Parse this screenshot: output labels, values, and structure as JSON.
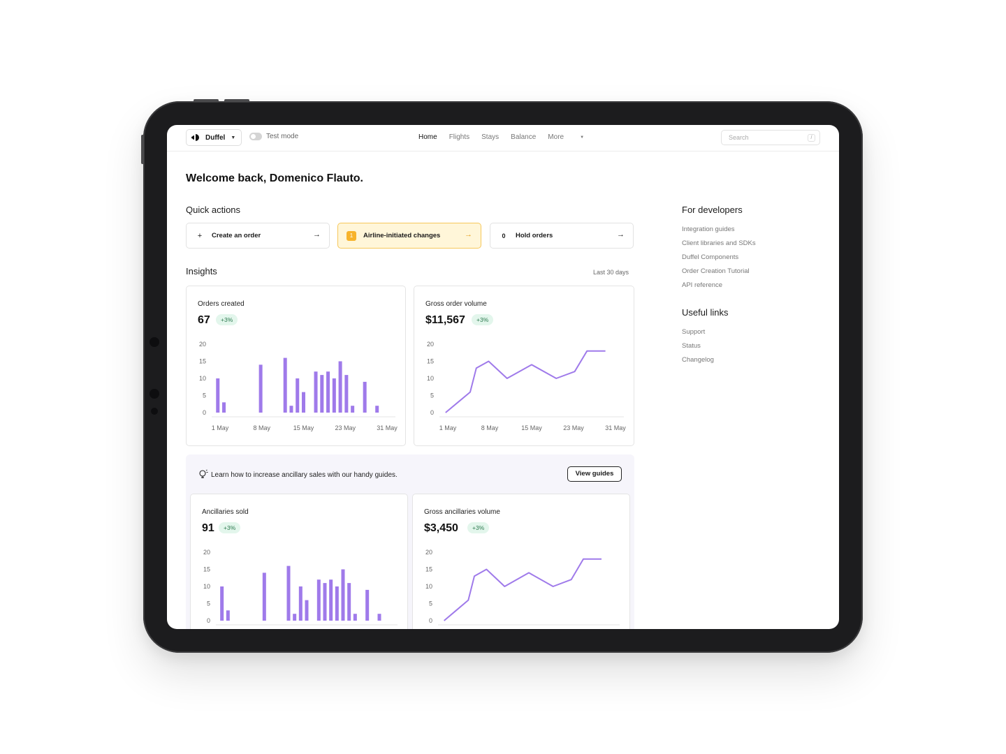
{
  "header": {
    "org_name": "Duffel",
    "test_mode_label": "Test mode",
    "nav": [
      "Home",
      "Flights",
      "Stays",
      "Balance",
      "More"
    ],
    "search_placeholder": "Search",
    "search_shortcut": "/"
  },
  "welcome": "Welcome back, Domenico Flauto.",
  "quick_actions": {
    "title": "Quick actions",
    "items": [
      {
        "label": "Create an order",
        "lead": "+"
      },
      {
        "label": "Airline-initiated changes",
        "lead": "1"
      },
      {
        "label": "Hold orders",
        "lead": "0"
      }
    ],
    "arrow": "→"
  },
  "insights": {
    "title": "Insights",
    "range": "Last 30 days"
  },
  "cards": [
    {
      "title": "Orders created",
      "value": "67",
      "change": "+3%"
    },
    {
      "title": "Gross order volume",
      "value": "$11,567",
      "change": "+3%"
    },
    {
      "title": "Ancillaries sold",
      "value": "91",
      "change": "+3%"
    },
    {
      "title": "Gross ancillaries volume",
      "value": "$3,450",
      "change": "+3%"
    }
  ],
  "promo": {
    "text": "Learn how to increase ancillary sales with our handy guides.",
    "button": "View guides"
  },
  "developers": {
    "title": "For developers",
    "links": [
      "Integration guides",
      "Client libraries and SDKs",
      "Duffel Components",
      "Order Creation Tutorial",
      "API reference"
    ]
  },
  "useful_links": {
    "title": "Useful links",
    "links": [
      "Support",
      "Status",
      "Changelog"
    ]
  },
  "colors": {
    "accent": "#9f7aea",
    "warning_bg": "#fff6d9",
    "warning_border": "#f6c75a",
    "badge_bg": "#e3f6ec"
  },
  "chart_data": [
    {
      "type": "bar",
      "x": [
        1,
        2,
        8,
        12,
        13,
        14,
        15,
        17,
        18,
        19,
        20,
        21,
        22,
        23,
        25,
        27
      ],
      "values": [
        10,
        3,
        14,
        16,
        2,
        10,
        6,
        12,
        11,
        12,
        10,
        15,
        11,
        2,
        9,
        2
      ],
      "xticks": [
        "1 May",
        "8 May",
        "15 May",
        "23 May",
        "31 May"
      ],
      "yticks": [
        "20",
        "15",
        "10",
        "5",
        "0"
      ],
      "ylim": [
        0,
        20
      ]
    },
    {
      "type": "line",
      "x": [
        1,
        3,
        5,
        6,
        8,
        11,
        15,
        19,
        22,
        24,
        25,
        27
      ],
      "values": [
        0,
        3,
        6,
        13,
        15,
        10,
        14,
        10,
        12,
        18,
        18,
        18
      ],
      "xticks": [
        "1 May",
        "8 May",
        "15 May",
        "23 May",
        "31 May"
      ],
      "yticks": [
        "20",
        "15",
        "10",
        "5",
        "0"
      ],
      "ylim": [
        0,
        20
      ]
    },
    {
      "type": "bar",
      "x": [
        1,
        2,
        8,
        12,
        13,
        14,
        15,
        17,
        18,
        19,
        20,
        21,
        22,
        23,
        25,
        27
      ],
      "values": [
        10,
        3,
        14,
        16,
        2,
        10,
        6,
        12,
        11,
        12,
        10,
        15,
        11,
        2,
        9,
        2
      ],
      "xticks": [],
      "yticks": [
        "20",
        "15",
        "10",
        "5",
        "0"
      ],
      "ylim": [
        0,
        20
      ]
    },
    {
      "type": "line",
      "x": [
        1,
        3,
        5,
        6,
        8,
        11,
        15,
        19,
        22,
        24,
        25,
        27
      ],
      "values": [
        0,
        3,
        6,
        13,
        15,
        10,
        14,
        10,
        12,
        18,
        18,
        18
      ],
      "xticks": [],
      "yticks": [
        "20",
        "15",
        "10",
        "5",
        "0"
      ],
      "ylim": [
        0,
        20
      ]
    }
  ]
}
